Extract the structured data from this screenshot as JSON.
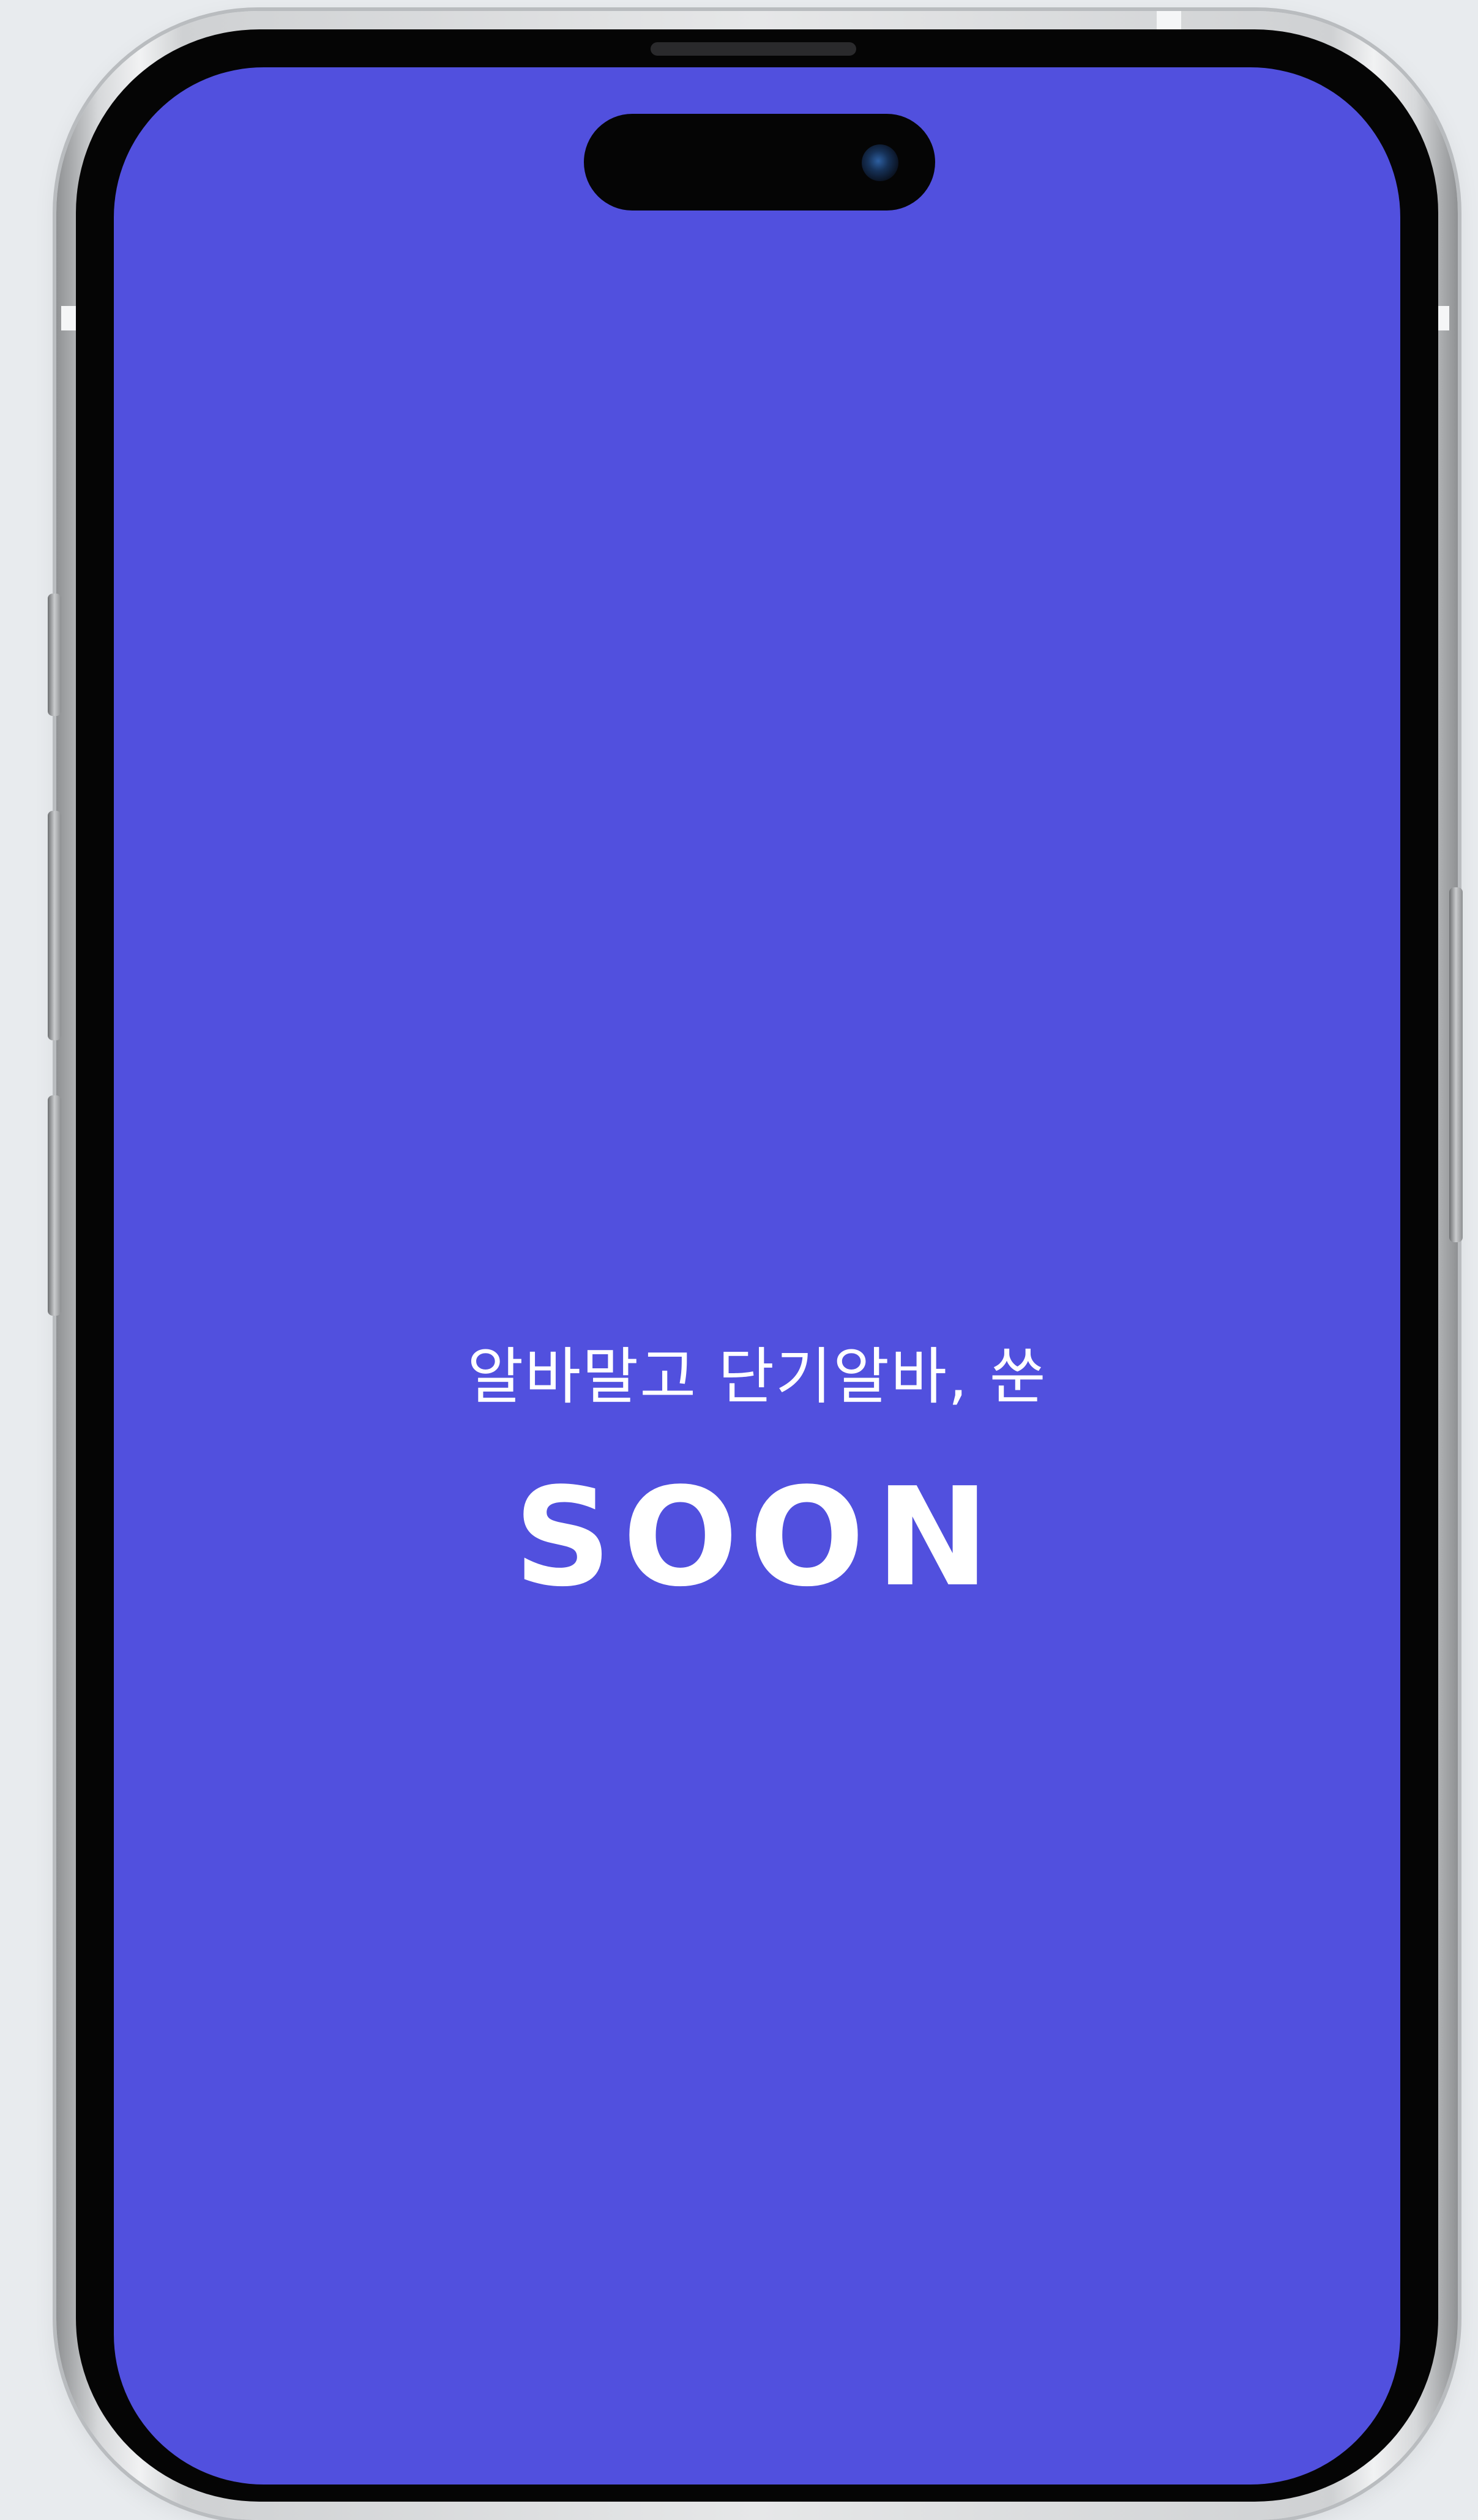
{
  "app": {
    "background_color": "#5150de",
    "text_color": "#ffffff"
  },
  "splash": {
    "tagline": "알바말고 단기알바, 쑨",
    "logo_text": "SOON"
  },
  "device": {
    "frame_color": "#e6e7e8",
    "bezel_color": "#050505"
  }
}
